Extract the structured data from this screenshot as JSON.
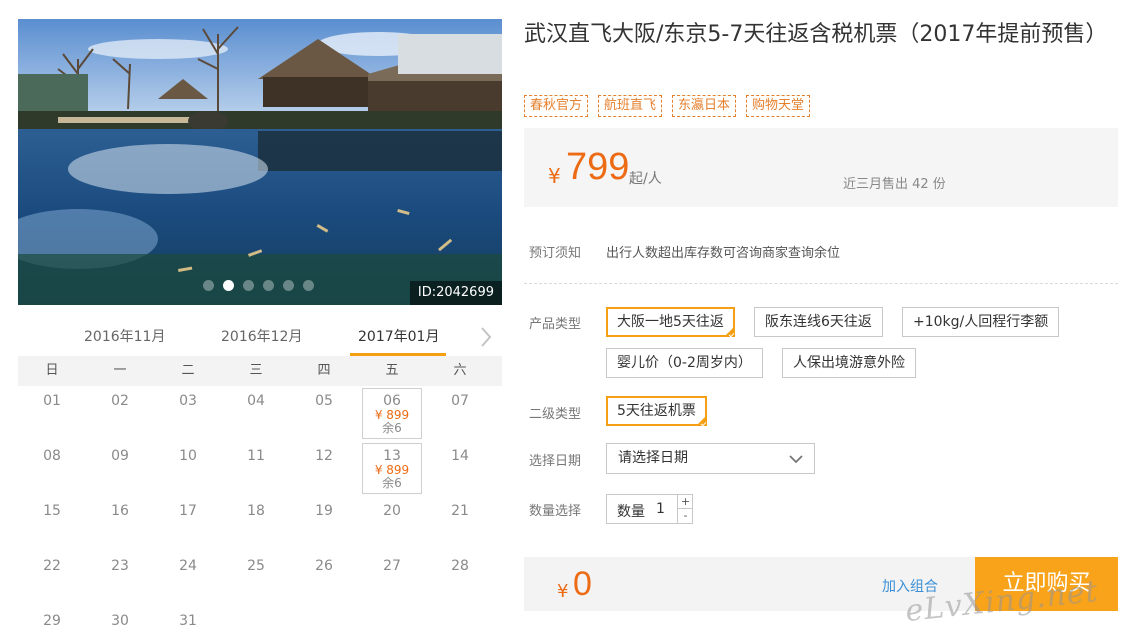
{
  "gallery": {
    "photo_id": "ID:2042699",
    "slides": 6,
    "active_slide": 2
  },
  "calendar": {
    "months": [
      "2016年11月",
      "2016年12月",
      "2017年01月"
    ],
    "active_month": "2017年01月",
    "weekdays": [
      "日",
      "一",
      "二",
      "三",
      "四",
      "五",
      "六"
    ],
    "days": [
      {
        "d": "01"
      },
      {
        "d": "02"
      },
      {
        "d": "03"
      },
      {
        "d": "04"
      },
      {
        "d": "05"
      },
      {
        "d": "06",
        "price": "¥ 899",
        "stock": "余6"
      },
      {
        "d": "07"
      },
      {
        "d": "08"
      },
      {
        "d": "09"
      },
      {
        "d": "10"
      },
      {
        "d": "11"
      },
      {
        "d": "12"
      },
      {
        "d": "13",
        "price": "¥ 899",
        "stock": "余6"
      },
      {
        "d": "14"
      },
      {
        "d": "15"
      },
      {
        "d": "16"
      },
      {
        "d": "17"
      },
      {
        "d": "18"
      },
      {
        "d": "19"
      },
      {
        "d": "20"
      },
      {
        "d": "21"
      },
      {
        "d": "22"
      },
      {
        "d": "23"
      },
      {
        "d": "24"
      },
      {
        "d": "25"
      },
      {
        "d": "26"
      },
      {
        "d": "27"
      },
      {
        "d": "28"
      },
      {
        "d": "29"
      },
      {
        "d": "30"
      },
      {
        "d": "31"
      }
    ]
  },
  "product": {
    "title": "武汉直飞大阪/东京5-7天往返含税机票（2017年提前预售）",
    "tags": [
      "春秋官方",
      "航班直飞",
      "东瀛日本",
      "购物天堂"
    ],
    "price": {
      "currency": "¥",
      "amount": "799",
      "unit": "起/人",
      "sold": "近三月售出 42 份"
    }
  },
  "booking": {
    "notice_label": "预订须知",
    "notice_text": "出行人数超出库存数可咨询商家查询余位",
    "type_label": "产品类型",
    "types": [
      "大阪一地5天往返",
      "阪东连线6天往返",
      "+10kg/人回程行李额",
      "婴儿价（0-2周岁内）",
      "人保出境游意外险"
    ],
    "selected_type": "大阪一地5天往返",
    "subtype_label": "二级类型",
    "subtypes": [
      "5天往返机票"
    ],
    "date_label": "选择日期",
    "date_placeholder": "请选择日期",
    "qty_label": "数量选择",
    "qty_inner_label": "数量",
    "qty_value": "1",
    "qty_plus": "+",
    "qty_minus": "-"
  },
  "checkout": {
    "currency": "¥",
    "total": "0",
    "combo_link": "加入组合",
    "buy_button": "立即购买"
  },
  "watermark": "eLvXing.net",
  "colors": {
    "accent_orange": "#ec6b14",
    "button_orange": "#f8a31a",
    "selected_border": "#f5a013",
    "link_blue": "#3b8fd6"
  }
}
